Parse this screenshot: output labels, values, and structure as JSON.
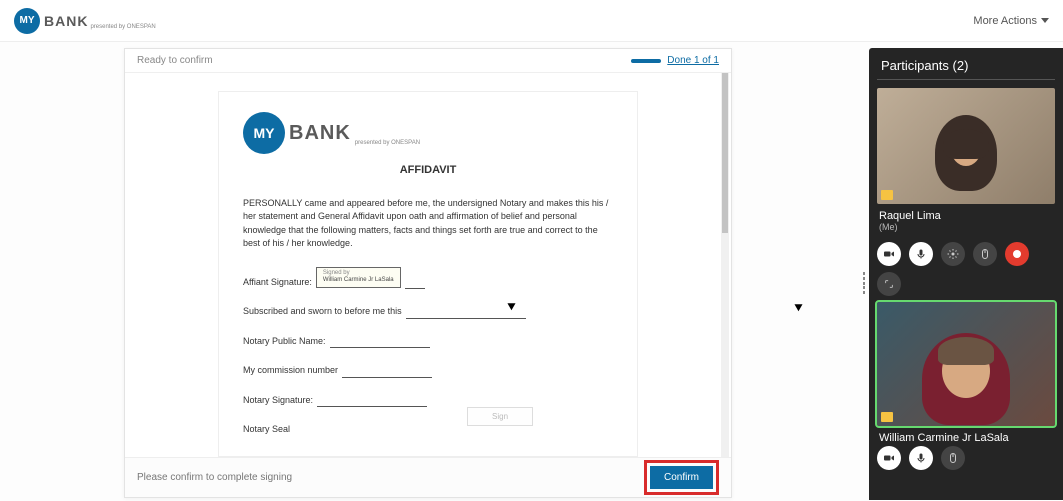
{
  "header": {
    "brand_circle": "MY",
    "brand_text": "BANK",
    "brand_sub": "presented by ONESPAN",
    "more_actions": "More Actions"
  },
  "doc": {
    "status": "Ready to confirm",
    "progress_text": "Done 1 of 1",
    "done_fab": "Done",
    "title": "AFFIDAVIT",
    "brand_circle": "MY",
    "brand_text": "BANK",
    "brand_sub": "presented by ONESPAN",
    "intro": "PERSONALLY came and appeared before me, the undersigned Notary and makes this his / her statement and General Affidavit upon oath and affirmation of belief and personal knowledge that the following matters, facts and things set forth are true and correct to the best of his / her knowledge.",
    "affiant_label": "Affiant Signature:",
    "sig_signed_by": "Signed by",
    "sig_name": "William Carmine Jr LaSala",
    "sworn_label": "Subscribed and sworn to before me this",
    "notary_name_label": "Notary Public Name:",
    "commission_label": "My commission number",
    "notary_sig_label": "Notary Signature:",
    "seal_label": "Notary Seal",
    "sign_placeholder_btn": "Sign",
    "footer_msg": "Please confirm to complete signing",
    "confirm_btn": "Confirm"
  },
  "participants": {
    "title": "Participants (2)",
    "p1_name": "Raquel Lima",
    "p1_me": "(Me)",
    "p2_name": "William Carmine Jr LaSala"
  },
  "icons": {
    "camera": "camera-icon",
    "mic": "mic-icon",
    "gear": "gear-icon",
    "mouse": "mouse-icon",
    "record": "record-icon",
    "expand": "expand-icon",
    "check": "check-icon",
    "chevron_down": "chevron-down-icon"
  }
}
